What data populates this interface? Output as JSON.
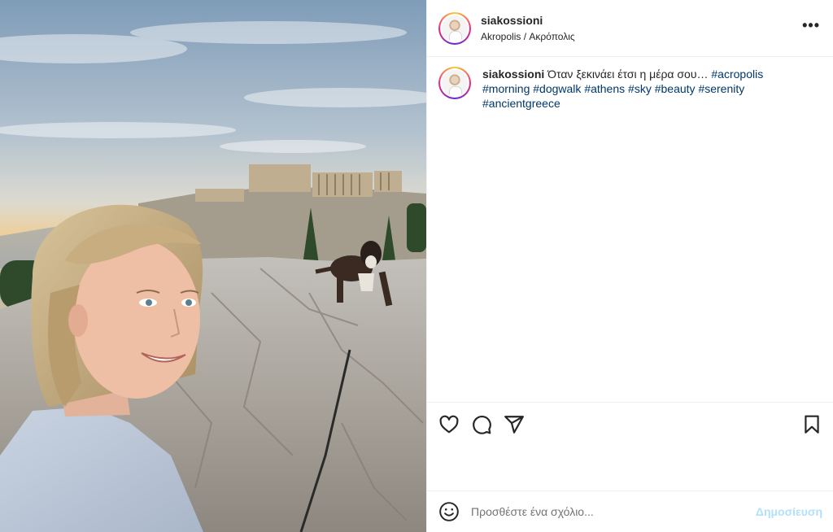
{
  "post": {
    "photo_alt": "Selfie of a woman with a boxer dog on rocks in front of the Acropolis",
    "header": {
      "username": "siakossioni",
      "location": "Akropolis / Ακρόπολις",
      "more_icon": "more-horizontal-icon",
      "more_label": "•••"
    },
    "caption": {
      "username": "siakossioni",
      "text": "Όταν ξεκινάει έτσι η μέρα σου…",
      "hashtags": [
        "#acropolis",
        "#morning",
        "#dogwalk",
        "#athens",
        "#sky",
        "#beauty",
        "#serenity",
        "#ancientgreece"
      ]
    },
    "actions": {
      "like_icon": "heart-icon",
      "comment_icon": "comment-icon",
      "share_icon": "send-icon",
      "save_icon": "bookmark-icon"
    },
    "comment": {
      "emoji_icon": "emoji-icon",
      "placeholder": "Προσθέστε ένα σχόλιο...",
      "post_label": "Δημοσίευση"
    },
    "colors": {
      "hashtag": "#00376b",
      "post_button_disabled": "#b2dffc",
      "border": "#efefef",
      "story_ring": [
        "#f9ce34",
        "#ee2a7b",
        "#6228d7"
      ]
    }
  }
}
